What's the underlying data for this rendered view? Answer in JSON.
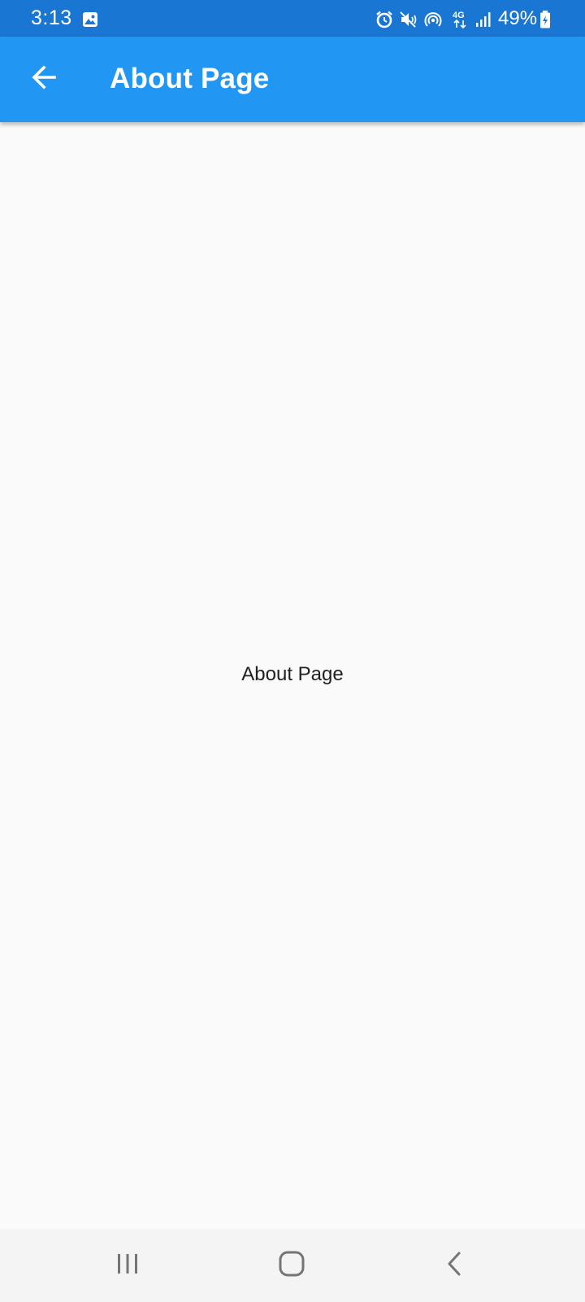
{
  "status_bar": {
    "time": "3:13",
    "battery": "49%",
    "icons": [
      "gallery-icon",
      "alarm-icon",
      "mute-icon",
      "hotspot-icon",
      "4g-data-icon",
      "signal-icon",
      "battery-icon"
    ],
    "network_label": "4G",
    "background_color": "#1976d2"
  },
  "app_bar": {
    "title": "About Page",
    "back_icon": "arrow-left-icon",
    "background_color": "#2196f3"
  },
  "body": {
    "text": "About Page"
  },
  "nav_bar": {
    "buttons": [
      "recent-apps-icon",
      "home-icon",
      "back-icon"
    ]
  }
}
